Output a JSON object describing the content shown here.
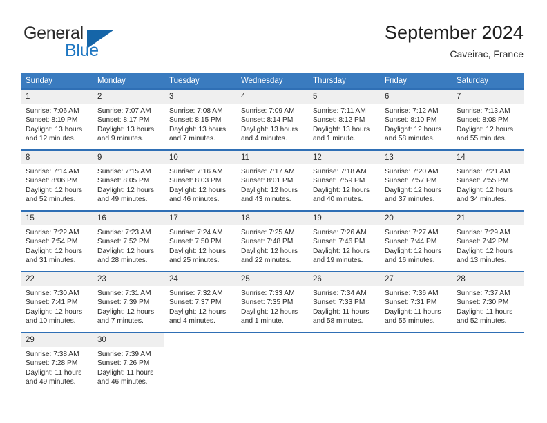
{
  "brand": {
    "name_part1": "General",
    "name_part2": "Blue",
    "flag_icon": "triangle-flag-icon"
  },
  "header": {
    "title": "September 2024",
    "location": "Caveirac, France"
  },
  "calendar": {
    "weekday_headers": [
      "Sunday",
      "Monday",
      "Tuesday",
      "Wednesday",
      "Thursday",
      "Friday",
      "Saturday"
    ],
    "header_bg": "#3a7bbf",
    "row_border": "#2f6fb5",
    "daynum_bg": "#efefef",
    "weeks": [
      [
        {
          "day": "1",
          "sunrise": "Sunrise: 7:06 AM",
          "sunset": "Sunset: 8:19 PM",
          "daylight": "Daylight: 13 hours and 12 minutes."
        },
        {
          "day": "2",
          "sunrise": "Sunrise: 7:07 AM",
          "sunset": "Sunset: 8:17 PM",
          "daylight": "Daylight: 13 hours and 9 minutes."
        },
        {
          "day": "3",
          "sunrise": "Sunrise: 7:08 AM",
          "sunset": "Sunset: 8:15 PM",
          "daylight": "Daylight: 13 hours and 7 minutes."
        },
        {
          "day": "4",
          "sunrise": "Sunrise: 7:09 AM",
          "sunset": "Sunset: 8:14 PM",
          "daylight": "Daylight: 13 hours and 4 minutes."
        },
        {
          "day": "5",
          "sunrise": "Sunrise: 7:11 AM",
          "sunset": "Sunset: 8:12 PM",
          "daylight": "Daylight: 13 hours and 1 minute."
        },
        {
          "day": "6",
          "sunrise": "Sunrise: 7:12 AM",
          "sunset": "Sunset: 8:10 PM",
          "daylight": "Daylight: 12 hours and 58 minutes."
        },
        {
          "day": "7",
          "sunrise": "Sunrise: 7:13 AM",
          "sunset": "Sunset: 8:08 PM",
          "daylight": "Daylight: 12 hours and 55 minutes."
        }
      ],
      [
        {
          "day": "8",
          "sunrise": "Sunrise: 7:14 AM",
          "sunset": "Sunset: 8:06 PM",
          "daylight": "Daylight: 12 hours and 52 minutes."
        },
        {
          "day": "9",
          "sunrise": "Sunrise: 7:15 AM",
          "sunset": "Sunset: 8:05 PM",
          "daylight": "Daylight: 12 hours and 49 minutes."
        },
        {
          "day": "10",
          "sunrise": "Sunrise: 7:16 AM",
          "sunset": "Sunset: 8:03 PM",
          "daylight": "Daylight: 12 hours and 46 minutes."
        },
        {
          "day": "11",
          "sunrise": "Sunrise: 7:17 AM",
          "sunset": "Sunset: 8:01 PM",
          "daylight": "Daylight: 12 hours and 43 minutes."
        },
        {
          "day": "12",
          "sunrise": "Sunrise: 7:18 AM",
          "sunset": "Sunset: 7:59 PM",
          "daylight": "Daylight: 12 hours and 40 minutes."
        },
        {
          "day": "13",
          "sunrise": "Sunrise: 7:20 AM",
          "sunset": "Sunset: 7:57 PM",
          "daylight": "Daylight: 12 hours and 37 minutes."
        },
        {
          "day": "14",
          "sunrise": "Sunrise: 7:21 AM",
          "sunset": "Sunset: 7:55 PM",
          "daylight": "Daylight: 12 hours and 34 minutes."
        }
      ],
      [
        {
          "day": "15",
          "sunrise": "Sunrise: 7:22 AM",
          "sunset": "Sunset: 7:54 PM",
          "daylight": "Daylight: 12 hours and 31 minutes."
        },
        {
          "day": "16",
          "sunrise": "Sunrise: 7:23 AM",
          "sunset": "Sunset: 7:52 PM",
          "daylight": "Daylight: 12 hours and 28 minutes."
        },
        {
          "day": "17",
          "sunrise": "Sunrise: 7:24 AM",
          "sunset": "Sunset: 7:50 PM",
          "daylight": "Daylight: 12 hours and 25 minutes."
        },
        {
          "day": "18",
          "sunrise": "Sunrise: 7:25 AM",
          "sunset": "Sunset: 7:48 PM",
          "daylight": "Daylight: 12 hours and 22 minutes."
        },
        {
          "day": "19",
          "sunrise": "Sunrise: 7:26 AM",
          "sunset": "Sunset: 7:46 PM",
          "daylight": "Daylight: 12 hours and 19 minutes."
        },
        {
          "day": "20",
          "sunrise": "Sunrise: 7:27 AM",
          "sunset": "Sunset: 7:44 PM",
          "daylight": "Daylight: 12 hours and 16 minutes."
        },
        {
          "day": "21",
          "sunrise": "Sunrise: 7:29 AM",
          "sunset": "Sunset: 7:42 PM",
          "daylight": "Daylight: 12 hours and 13 minutes."
        }
      ],
      [
        {
          "day": "22",
          "sunrise": "Sunrise: 7:30 AM",
          "sunset": "Sunset: 7:41 PM",
          "daylight": "Daylight: 12 hours and 10 minutes."
        },
        {
          "day": "23",
          "sunrise": "Sunrise: 7:31 AM",
          "sunset": "Sunset: 7:39 PM",
          "daylight": "Daylight: 12 hours and 7 minutes."
        },
        {
          "day": "24",
          "sunrise": "Sunrise: 7:32 AM",
          "sunset": "Sunset: 7:37 PM",
          "daylight": "Daylight: 12 hours and 4 minutes."
        },
        {
          "day": "25",
          "sunrise": "Sunrise: 7:33 AM",
          "sunset": "Sunset: 7:35 PM",
          "daylight": "Daylight: 12 hours and 1 minute."
        },
        {
          "day": "26",
          "sunrise": "Sunrise: 7:34 AM",
          "sunset": "Sunset: 7:33 PM",
          "daylight": "Daylight: 11 hours and 58 minutes."
        },
        {
          "day": "27",
          "sunrise": "Sunrise: 7:36 AM",
          "sunset": "Sunset: 7:31 PM",
          "daylight": "Daylight: 11 hours and 55 minutes."
        },
        {
          "day": "28",
          "sunrise": "Sunrise: 7:37 AM",
          "sunset": "Sunset: 7:30 PM",
          "daylight": "Daylight: 11 hours and 52 minutes."
        }
      ],
      [
        {
          "day": "29",
          "sunrise": "Sunrise: 7:38 AM",
          "sunset": "Sunset: 7:28 PM",
          "daylight": "Daylight: 11 hours and 49 minutes."
        },
        {
          "day": "30",
          "sunrise": "Sunrise: 7:39 AM",
          "sunset": "Sunset: 7:26 PM",
          "daylight": "Daylight: 11 hours and 46 minutes."
        },
        {
          "day": "",
          "sunrise": "",
          "sunset": "",
          "daylight": ""
        },
        {
          "day": "",
          "sunrise": "",
          "sunset": "",
          "daylight": ""
        },
        {
          "day": "",
          "sunrise": "",
          "sunset": "",
          "daylight": ""
        },
        {
          "day": "",
          "sunrise": "",
          "sunset": "",
          "daylight": ""
        },
        {
          "day": "",
          "sunrise": "",
          "sunset": "",
          "daylight": ""
        }
      ]
    ]
  }
}
